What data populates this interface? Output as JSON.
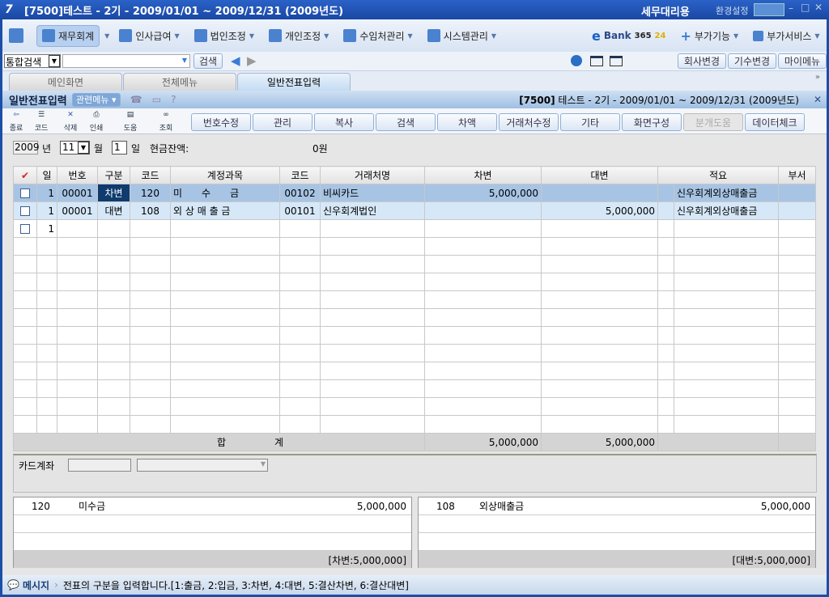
{
  "window": {
    "title": "[7500]테스트 - 2기 - 2009/01/01 ~ 2009/12/31 (2009년도)",
    "mode": "세무대리용",
    "settings": "환경설정"
  },
  "menu": {
    "items": [
      {
        "label": "재무회계"
      },
      {
        "label": "인사급여"
      },
      {
        "label": "법인조정"
      },
      {
        "label": "개인조정"
      },
      {
        "label": "수임처관리"
      },
      {
        "label": "시스템관리"
      }
    ],
    "ebank": "Bank",
    "ebank_num": "365",
    "ebank_num2": "24",
    "extra": [
      "부가기능",
      "부가서비스"
    ]
  },
  "search": {
    "scope": "통합검색",
    "value": "",
    "button": "검색",
    "right_buttons": [
      "회사변경",
      "기수변경",
      "마이메뉴"
    ]
  },
  "tabs": [
    {
      "label": "메인화면"
    },
    {
      "label": "전체메뉴"
    },
    {
      "label": "일반전표입력"
    }
  ],
  "form": {
    "title": "일반전표입력",
    "related": "관련메뉴",
    "company": "[7500]",
    "company_info": "테스트 - 2기 - 2009/01/01 ~ 2009/12/31 (2009년도)"
  },
  "toolbar": {
    "icons": [
      "종료",
      "코드",
      "삭제",
      "인쇄",
      "도움",
      "조회"
    ],
    "buttons": [
      "번호수정",
      "관리",
      "복사",
      "검색",
      "차액",
      "거래처수정",
      "기타",
      "화면구성",
      "분개도움",
      "데이터체크"
    ]
  },
  "date": {
    "year": "2009",
    "year_label": "년",
    "month": "11",
    "month_label": "월",
    "day": "1",
    "day_label": "일",
    "cash_label": "현금잔액:",
    "cash_value": "0원"
  },
  "grid": {
    "headers": [
      "일",
      "번호",
      "구분",
      "코드",
      "계정과목",
      "코드",
      "거래처명",
      "차변",
      "대변",
      "적요",
      "부서"
    ],
    "rows": [
      {
        "day": "1",
        "no": "00001",
        "type": "차변",
        "code": "120",
        "account": "미　　수　　금",
        "pcode": "00102",
        "partner": "비씨카드",
        "debit": "5,000,000",
        "credit": "",
        "memo": "신우회계외상매출금"
      },
      {
        "day": "1",
        "no": "00001",
        "type": "대변",
        "code": "108",
        "account": "외 상 매 출 금",
        "pcode": "00101",
        "partner": "신우회계법인",
        "debit": "",
        "credit": "5,000,000",
        "memo": "신우회계외상매출금"
      },
      {
        "day": "1",
        "no": "",
        "type": "",
        "code": "",
        "account": "",
        "pcode": "",
        "partner": "",
        "debit": "",
        "credit": "",
        "memo": ""
      }
    ],
    "total_label": "합　　　　　계",
    "total_debit": "5,000,000",
    "total_credit": "5,000,000"
  },
  "card": {
    "label": "카드계좌"
  },
  "summary": {
    "left": {
      "code": "120",
      "name": "미수금",
      "amount": "5,000,000",
      "footer": "[차변:5,000,000]"
    },
    "right": {
      "code": "108",
      "name": "외상매출금",
      "amount": "5,000,000",
      "footer": "[대변:5,000,000]"
    }
  },
  "status": {
    "label": "메시지",
    "message": "전표의 구분을 입력합니다.[1:출금, 2:입금, 3:차변, 4:대변, 5:결산차변, 6:결산대변]"
  }
}
